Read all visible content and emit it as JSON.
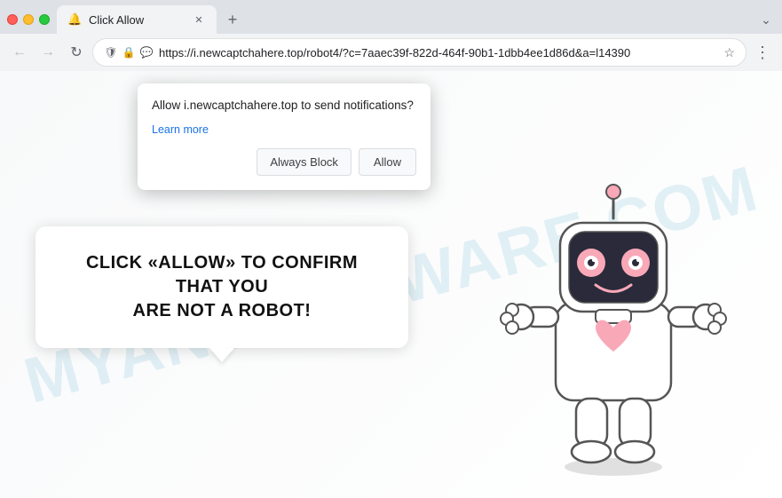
{
  "browser": {
    "tab": {
      "title": "Click Allow",
      "favicon": "🔔"
    },
    "address": {
      "url": "https://i.newcaptchahere.top/robot4/?c=7aaec39f-822d-464f-90b1-1dbb4ee1d86d&a=l14390"
    },
    "new_tab_label": "+",
    "menu_dots": "⋮",
    "back_arrow": "←",
    "forward_arrow": "→",
    "refresh": "↻"
  },
  "notification_popup": {
    "message": "Allow i.newcaptchahere.top to send notifications?",
    "learn_more_label": "Learn more",
    "always_block_label": "Always Block",
    "allow_label": "Allow"
  },
  "page": {
    "main_text_line1": "CLICK «ALLOW» TO CONFIRM THAT YOU",
    "main_text_line2": "ARE NOT A ROBOT!",
    "watermark": "MYANTISPYWARE.COM"
  },
  "icons": {
    "shield": "🛡",
    "lock": "🔒",
    "chat": "💬",
    "star": "☆",
    "close": "✕"
  }
}
